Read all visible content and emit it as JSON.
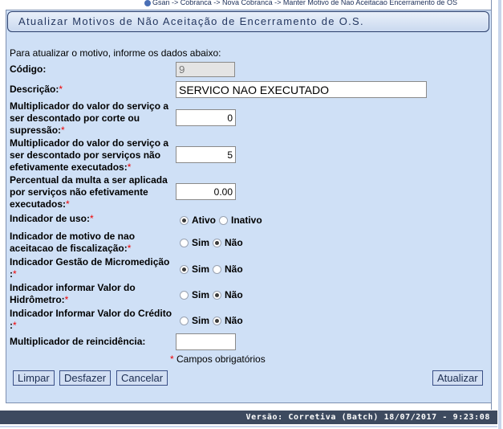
{
  "breadcrumb": "Gsan -> Cobranca -> Nova Cobranca -> Manter Motivo de Nao Aceitacao Encerramento de OS",
  "title": "Atualizar Motivos de Não Aceitação de Encerramento de O.S.",
  "intro": "Para atualizar o motivo, informe os dados abaixo:",
  "required_mark": "*",
  "fields": {
    "codigo": {
      "label": "Código:",
      "value": "9"
    },
    "descricao": {
      "label": "Descrição:",
      "value": "SERVICO NAO EXECUTADO"
    },
    "mult_corte": {
      "label_lines": [
        "Multiplicador do valor do serviço a",
        "ser descontado por corte ou",
        "supressão:"
      ],
      "value": "0"
    },
    "mult_nao_exec": {
      "label_lines": [
        "Multiplicador do valor do serviço a",
        "ser descontado por serviços não",
        "efetivamente executados:"
      ],
      "value": "5"
    },
    "perc_multa": {
      "label_lines": [
        "Percentual da multa a ser aplicada",
        "por serviços não efetivamente",
        "executados:"
      ],
      "value": "0.00"
    },
    "indicador_uso": {
      "label": "Indicador de uso:",
      "options": [
        "Ativo",
        "Inativo"
      ],
      "selected": "Ativo"
    },
    "indicador_fiscalizacao": {
      "label_lines": [
        "Indicador de motivo de nao",
        "aceitacao de fiscalização:"
      ],
      "options": [
        "Sim",
        "Não"
      ],
      "selected": "Não"
    },
    "indicador_micromedicao": {
      "label_lines": [
        "Indicador Gestão de Micromedição",
        ":"
      ],
      "options": [
        "Sim",
        "Não"
      ],
      "selected": "Sim"
    },
    "indicador_valor_hidrometro": {
      "label_lines": [
        "Indicador informar Valor do",
        "Hidrômetro:"
      ],
      "options": [
        "Sim",
        "Não"
      ],
      "selected": "Não"
    },
    "indicador_valor_credito": {
      "label_lines": [
        "Indicador Informar Valor do Crédito",
        ":"
      ],
      "options": [
        "Sim",
        "Não"
      ],
      "selected": "Não"
    },
    "mult_reincidencia": {
      "label": "Multiplicador de reincidência:",
      "value": ""
    }
  },
  "required_note": "Campos obrigatórios",
  "buttons": {
    "limpar": "Limpar",
    "desfazer": "Desfazer",
    "cancelar": "Cancelar",
    "atualizar": "Atualizar"
  },
  "footer": "Versão: Corretiva (Batch) 18/07/2017 - 9:23:08"
}
